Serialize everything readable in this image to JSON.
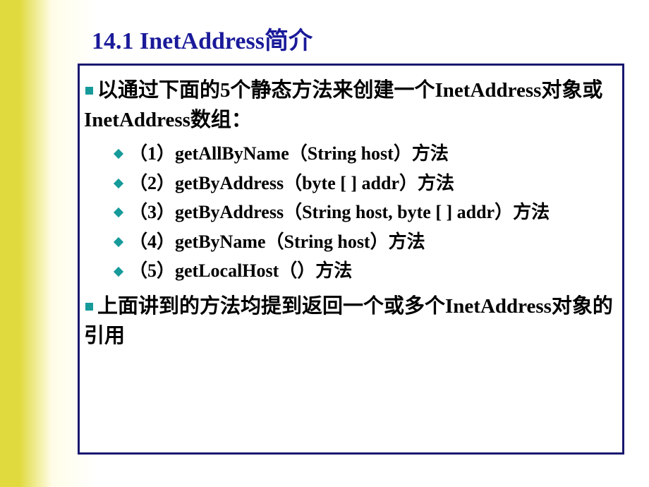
{
  "title": "14.1 InetAddress简介",
  "main1": "以通过下面的5个静态方法来创建一个InetAddress对象或InetAddress数组：",
  "subs": [
    "（1）getAllByName（String host）方法",
    "（2）getByAddress（byte [ ] addr）方法",
    "（3）getByAddress（String host, byte [ ] addr）方法",
    "（4）getByName（String host）方法",
    "（5）getLocalHost（）方法"
  ],
  "main2": "上面讲到的方法均提到返回一个或多个InetAddress对象的引用"
}
